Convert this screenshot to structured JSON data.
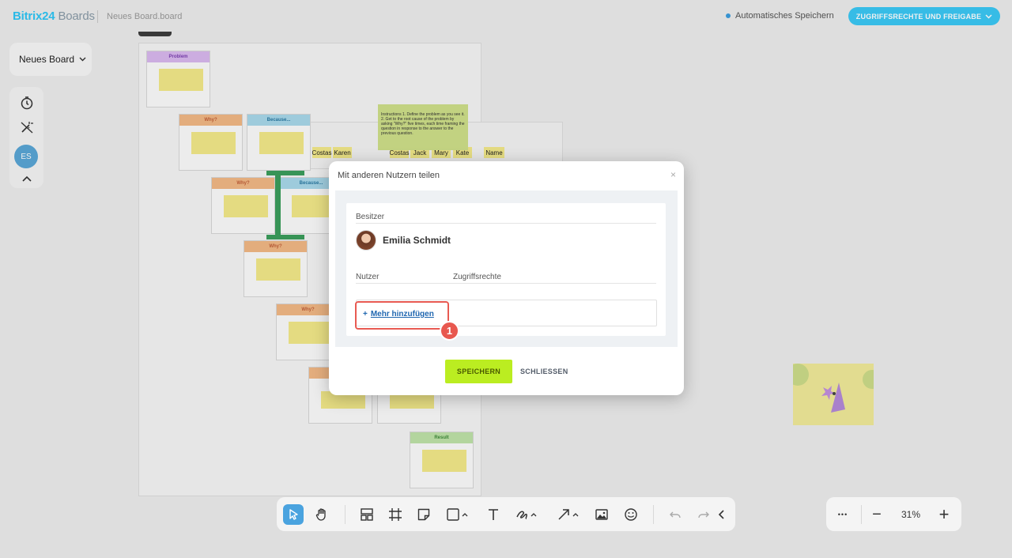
{
  "header": {
    "logo_brand": "Bitrix",
    "logo_num": "24",
    "logo_product": "Boards",
    "file_name": "Neues Board.board",
    "autosave_label": "Automatisches Speichern",
    "share_button": "ZUGRIFFSRECHTE UND FREIGABE"
  },
  "left": {
    "board_select": "Neues Board",
    "avatar_initials": "ES"
  },
  "board": {
    "problem": "Problem",
    "why": "Why?",
    "because": "Because...",
    "result": "Result",
    "names": [
      "Costas",
      "Karen",
      "Costas",
      "Jack",
      "Mary",
      "Kate",
      "Name"
    ],
    "instructions": "Instructions 1. Define the problem as you see it. 2. Get to the root cause of the problem by asking \"Why?\" five times, each time framing the question in response to the answer to the previous question."
  },
  "modal": {
    "title": "Mit anderen Nutzern teilen",
    "close": "×",
    "owner_label": "Besitzer",
    "owner_name": "Emilia Schmidt",
    "users_label": "Nutzer",
    "rights_label": "Zugriffsrechte",
    "add_plus": "+",
    "add_more": "Mehr hinzufügen",
    "save": "SPEICHERN",
    "cancel": "SCHLIESSEN",
    "step": "1"
  },
  "zoom": {
    "value": "31%",
    "more": "•••",
    "minus": "−",
    "plus": "+"
  },
  "colors": {
    "accent": "#3bc8f5",
    "save": "#bbed21",
    "highlight": "#e85a52"
  }
}
